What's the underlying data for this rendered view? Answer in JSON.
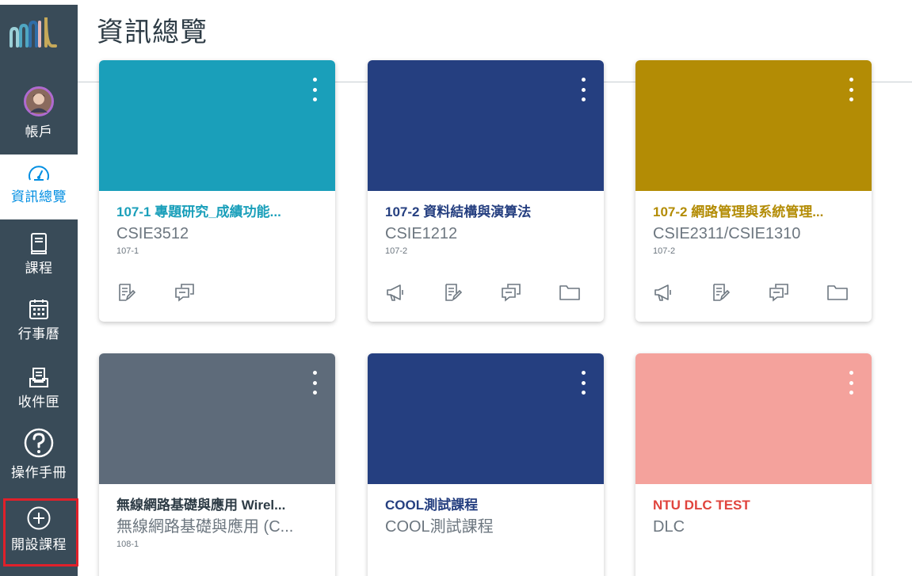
{
  "nav": {
    "logo": "canvas-logo",
    "items": [
      {
        "key": "account",
        "label": "帳戶",
        "icon": "avatar"
      },
      {
        "key": "dashboard",
        "label": "資訊總覽",
        "icon": "dashboard-icon",
        "active": true
      },
      {
        "key": "courses",
        "label": "課程",
        "icon": "book-icon"
      },
      {
        "key": "calendar",
        "label": "行事曆",
        "icon": "calendar-icon"
      },
      {
        "key": "inbox",
        "label": "收件匣",
        "icon": "inbox-icon"
      },
      {
        "key": "help",
        "label": "操作手冊",
        "icon": "help-icon"
      },
      {
        "key": "create-course",
        "label": "開設課程",
        "icon": "plus-circle-icon",
        "highlighted": true
      }
    ]
  },
  "page": {
    "title": "資訊總覽"
  },
  "colors": {
    "nav_bg": "#394b58",
    "nav_active_text": "#008ee2",
    "highlight": "#e0202a"
  },
  "cards": [
    {
      "title": "107-1 專題研究_成績功能...",
      "code": "CSIE3512",
      "term": "107-1",
      "color": "#1a9fba",
      "title_color": "#1a9fba",
      "actions": [
        "assignments-icon",
        "discussions-icon"
      ]
    },
    {
      "title": "107-2 資料結構與演算法",
      "code": "CSIE1212",
      "term": "107-2",
      "color": "#253f80",
      "title_color": "#253f80",
      "actions": [
        "announcements-icon",
        "assignments-icon",
        "discussions-icon",
        "files-icon"
      ]
    },
    {
      "title": "107-2 網路管理與系統管理...",
      "code": "CSIE2311/CSIE1310",
      "term": "107-2",
      "color": "#b38c05",
      "title_color": "#b38c05",
      "actions": [
        "announcements-icon",
        "assignments-icon",
        "discussions-icon",
        "files-icon"
      ]
    },
    {
      "title": "無線網路基礎與應用 Wirel...",
      "code": "無線網路基礎與應用 (C...",
      "term": "108-1",
      "color": "#5e6b7a",
      "title_color": "#2d3b45",
      "actions": []
    },
    {
      "title": "COOL測試課程",
      "code": "COOL測試課程",
      "term": "",
      "color": "#253f80",
      "title_color": "#253f80",
      "actions": []
    },
    {
      "title": "NTU DLC TEST",
      "code": "DLC",
      "term": "",
      "color": "#f4a29c",
      "title_color": "#e0443d",
      "actions": []
    }
  ]
}
